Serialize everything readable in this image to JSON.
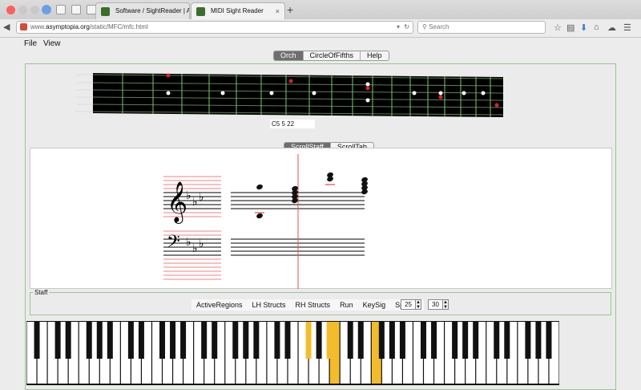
{
  "browser": {
    "tabs": [
      {
        "title": "Software / SightReader | A..."
      },
      {
        "title": "MIDI Sight Reader"
      }
    ],
    "new_tab": "+",
    "close": "×",
    "url_prefix": "www.",
    "url_domain": "asymptopia.org",
    "url_path": "/static/MFC/mfc.html",
    "search_placeholder": "Search"
  },
  "menubar": {
    "items": [
      "File",
      "View"
    ]
  },
  "top_tabs": [
    {
      "label": "Orch",
      "selected": true
    },
    {
      "label": "CircleOfFifths",
      "selected": false
    },
    {
      "label": "Help",
      "selected": false
    }
  ],
  "fretboard": {
    "readout": "C5 5 22"
  },
  "staff_tabs": [
    {
      "label": "ScrollStaff",
      "selected": true
    },
    {
      "label": "ScrollTab",
      "selected": false
    }
  ],
  "staff_panel": {
    "title": "Staff",
    "buttons": [
      "ActiveRegions",
      "LH Structs",
      "RH Structs",
      "Run",
      "KeySig",
      "Special"
    ],
    "spinner1": "25",
    "spinner2": "30"
  },
  "colors": {
    "accent": "#f2bc2c",
    "fret_dot_red": "#e02020",
    "panel_border": "#9bc493"
  }
}
